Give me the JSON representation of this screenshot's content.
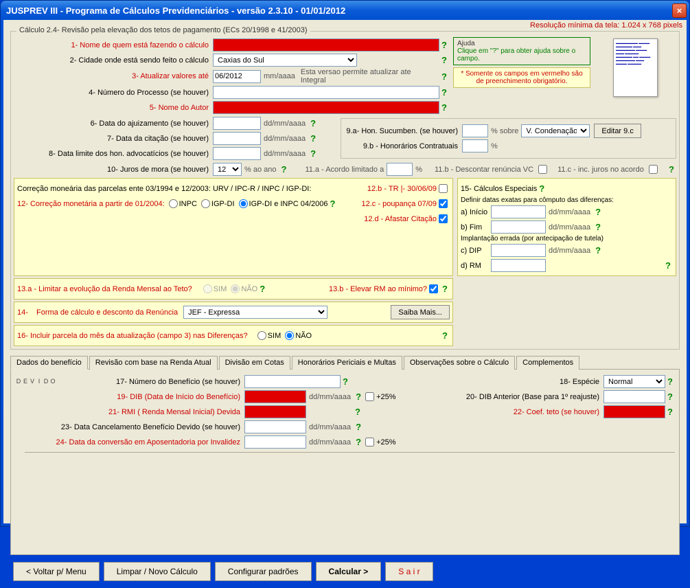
{
  "window_title": "JUSPREV III - Programa de Cálculos Previdenciários - versão 2.3.10  - 01/01/2012",
  "resolution_note": "Resolução mínima da tela: 1.024 x 768 pixels",
  "group_title": "Cálculo 2.4- Revisão pela elevação dos tetos de pagamento (ECs 20/1998 e 41/2003)",
  "labels": {
    "l1": "1- Nome de quem está fazendo o cálculo",
    "l2": "2- Cidade onde está sendo feito o cálculo",
    "l3": "3- Atualizar valores até",
    "l3_hint": "mm/aaaa",
    "l3_note": "Esta versao permite atualizar ate Integral",
    "l4": "4- Número do Processo (se houver)",
    "l5": "5- Nome do Autor",
    "l6": "6- Data do ajuizamento (se houver)",
    "l7": "7- Data da citação (se houver)",
    "l8": "8- Data limite dos hon. advocatícios (se houver)",
    "l9a": "9.a- Hon. Sucumben. (se houver)",
    "l9a_pct": "% sobre",
    "l9b": "9.b - Honorários Contratuais",
    "l9b_pct": "%",
    "editar9c": "Editar 9.c",
    "l10": "10- Juros de mora (se houver)",
    "l10_pct": "% ao ano",
    "l11a": "11.a - Acordo limitado a",
    "l11a_pct": "%",
    "l11b": "11.b - Descontar renúncia VC",
    "l11c": "11.c - inc. juros no acordo",
    "corr_header": "Correção moneária das parcelas ente 03/1994 e 12/2003: URV / IPC-R / INPC / IGP-DI:",
    "l12": "12- Correção monetária a partir de 01/2004:",
    "r_inpc": "INPC",
    "r_igpdi": "IGP-DI",
    "r_both": "IGP-DI e INPC 04/2006",
    "l12b": "12.b - TR |- 30/06/09",
    "l12c": "12.c - poupança 07/09",
    "l12d": "12.d - Afastar Citação",
    "l13a": "13.a - Limitar a evolução da Renda Mensal ao Teto?",
    "sim": "SIM",
    "nao": "NÃO",
    "l13b": "13.b - Elevar RM ao mínimo?",
    "l14": "14-",
    "l14_text": "Forma de cálculo e desconto da Renúncia",
    "saiba": "Saiba Mais...",
    "l15": "15- Cálculos Especiais",
    "l15_sub": "Definir datas exatas para cômputo das diferenças:",
    "l15a": "a) Início",
    "l15b": "b) Fim",
    "l15_impl": "Implantação errada (por antecipação de tutela)",
    "l15c": "c) DIP",
    "l15d": "d) RM",
    "l16": "16- Incluir parcela do mês da atualização (campo 3) nas Diferenças?",
    "dd": "dd/mm/aaaa",
    "devido": "DEVIDO",
    "l17": "17- Número do Benefício (se houver)",
    "l18": "18- Espécie",
    "l19": "19- DIB (Data de Início do Benefício)",
    "l20": "20- DIB Anterior (Base para 1º reajuste)",
    "l21": "21- RMI ( Renda Mensal Inicial) Devida",
    "l22": "22- Coef. teto (se houver)",
    "l23": "23- Data Cancelamento  Benefício Devido (se houver)",
    "l24": "24- Data da conversão em Aposentadoria por Invalidez",
    "p25": "+25%"
  },
  "help": {
    "title": "Ajuda",
    "text": "Clique em \"?\" para obter ajuda sobre o campo.",
    "warn": "* Somente os campos em vermelho são de preenchimento obrigatório."
  },
  "values": {
    "cidade": "Caxias do Sul",
    "atualizar": "06/2012",
    "juros": "12",
    "vcond": "V. Condenação",
    "renuncia": "JEF - Expressa",
    "especie": "Normal"
  },
  "tabs": [
    "Dados do benefício",
    "Revisão com base na Renda Atual",
    "Divisão em Cotas",
    "Honorários Periciais e Multas",
    "Observações sobre o Cálculo",
    "Complementos"
  ],
  "buttons": {
    "voltar": "<  Voltar p/ Menu",
    "limpar": "Limpar / Novo Cálculo",
    "config": "Configurar padrões",
    "calcular": "Calcular >",
    "sair": "S a i r"
  }
}
